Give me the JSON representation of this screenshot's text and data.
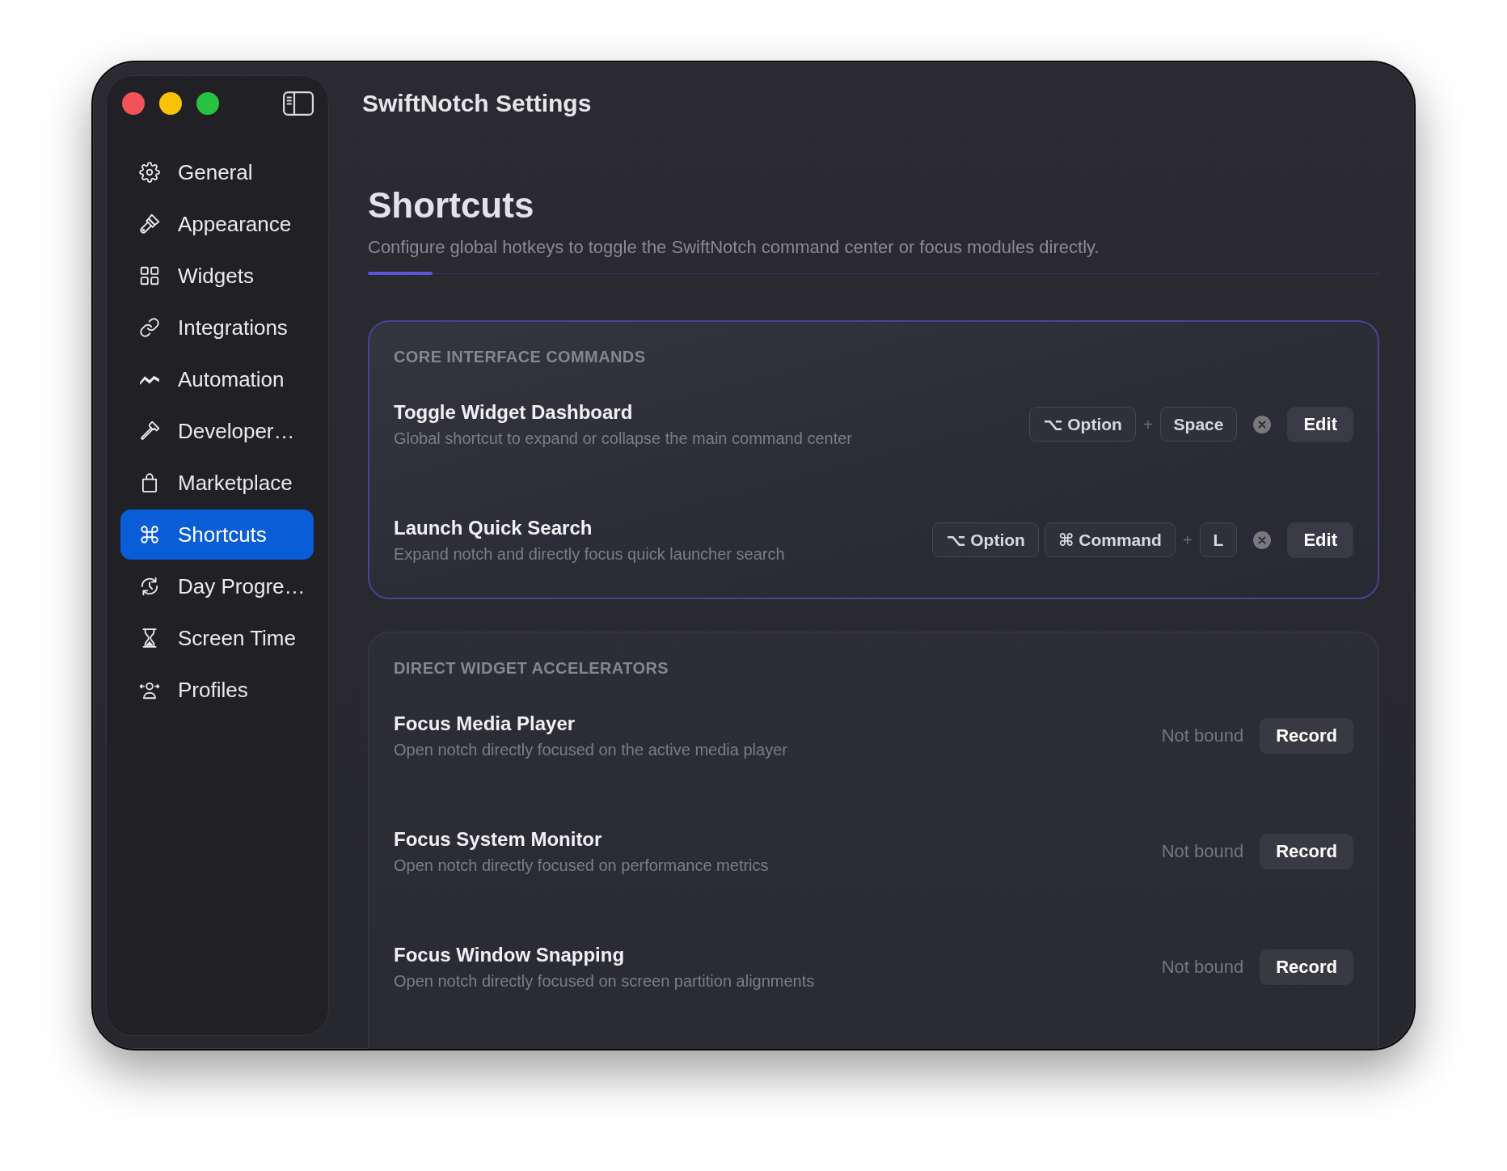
{
  "window": {
    "title": "SwiftNotch Settings"
  },
  "sidebar": {
    "items": [
      {
        "label": "General",
        "selected": false
      },
      {
        "label": "Appearance",
        "selected": false
      },
      {
        "label": "Widgets",
        "selected": false
      },
      {
        "label": "Integrations",
        "selected": false
      },
      {
        "label": "Automation",
        "selected": false
      },
      {
        "label": "Developer…",
        "selected": false
      },
      {
        "label": "Marketplace",
        "selected": false
      },
      {
        "label": "Shortcuts",
        "selected": true
      },
      {
        "label": "Day Progre…",
        "selected": false
      },
      {
        "label": "Screen Time",
        "selected": false
      },
      {
        "label": "Profiles",
        "selected": false
      }
    ]
  },
  "page": {
    "title": "Shortcuts",
    "subtitle": "Configure global hotkeys to toggle the SwiftNotch command center or focus modules directly."
  },
  "sections": [
    {
      "title": "CORE INTERFACE COMMANDS",
      "highlighted": true,
      "rows": [
        {
          "kind": "bound",
          "title": "Toggle Widget Dashboard",
          "description": "Global shortcut to expand or collapse the main command center",
          "keys": [
            {
              "kind": "key",
              "label": "⌥ Option"
            },
            {
              "kind": "plus",
              "label": "+"
            },
            {
              "kind": "key",
              "label": "Space"
            }
          ],
          "button": "Edit"
        },
        {
          "kind": "bound",
          "title": "Launch Quick Search",
          "description": "Expand notch and directly focus quick launcher search",
          "keys": [
            {
              "kind": "key",
              "label": "⌥ Option"
            },
            {
              "kind": "key",
              "label": "⌘ Command"
            },
            {
              "kind": "plus",
              "label": "+"
            },
            {
              "kind": "key",
              "label": "L"
            }
          ],
          "button": "Edit"
        }
      ]
    },
    {
      "title": "DIRECT WIDGET ACCELERATORS",
      "highlighted": false,
      "rows": [
        {
          "kind": "unbound",
          "title": "Focus Media Player",
          "description": "Open notch directly focused on the active media player",
          "status": "Not bound",
          "button": "Record"
        },
        {
          "kind": "unbound",
          "title": "Focus System Monitor",
          "description": "Open notch directly focused on performance metrics",
          "status": "Not bound",
          "button": "Record"
        },
        {
          "kind": "unbound",
          "title": "Focus Window Snapping",
          "description": "Open notch directly focused on screen partition alignments",
          "status": "Not bound",
          "button": "Record"
        }
      ]
    }
  ]
}
